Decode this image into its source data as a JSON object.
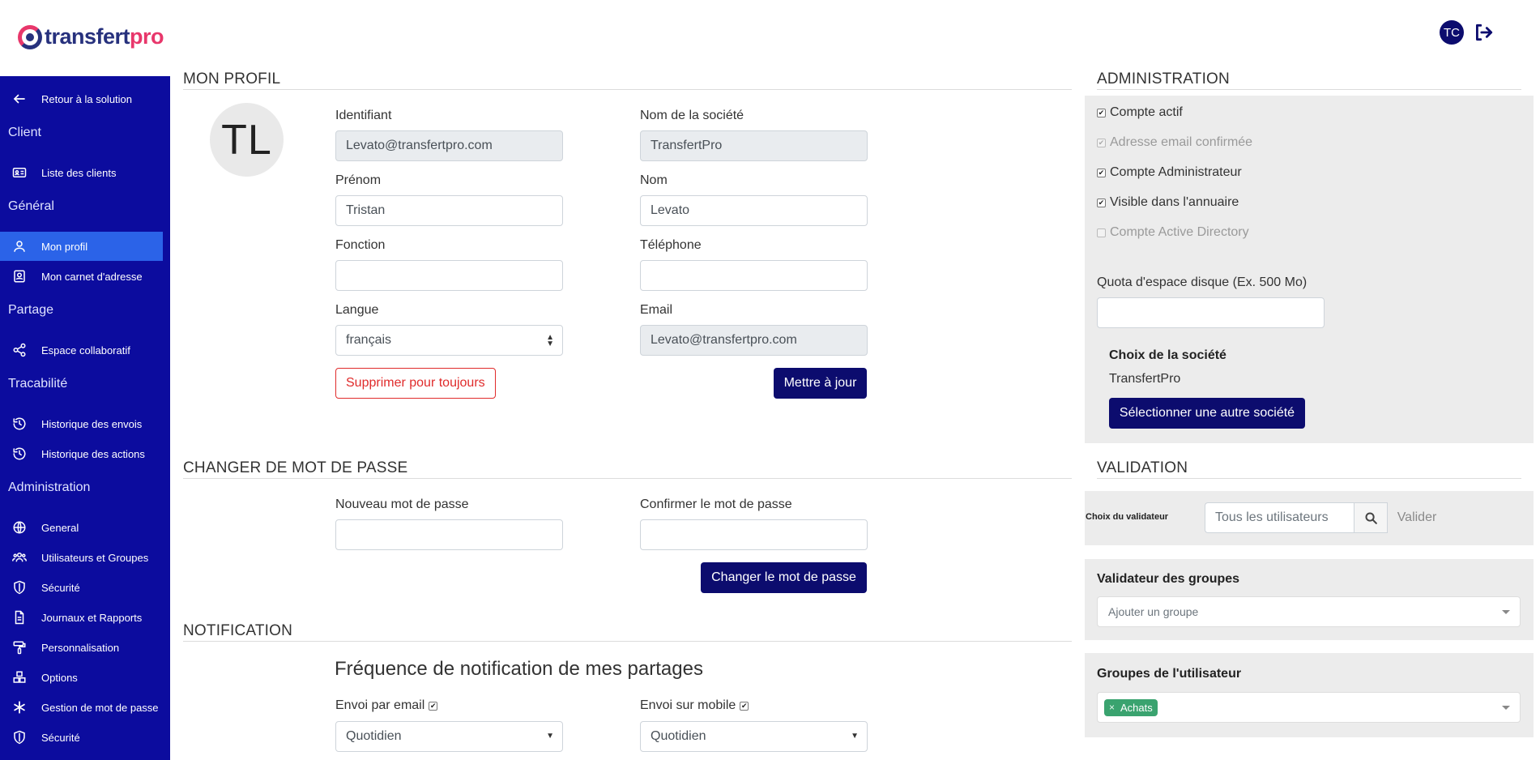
{
  "header": {
    "logo_left": "transfert",
    "logo_right": "pro",
    "user_initials": "TC"
  },
  "sidebar": {
    "back": "Retour à la solution",
    "sections": {
      "client": "Client",
      "general": "Général",
      "partage": "Partage",
      "tracabilite": "Tracabilité",
      "administration": "Administration"
    },
    "items": {
      "clients": "Liste des clients",
      "profil": "Mon profil",
      "carnet": "Mon carnet d'adresse",
      "espace": "Espace collaboratif",
      "hist_envois": "Historique des envois",
      "hist_actions": "Historique des actions",
      "general": "General",
      "users": "Utilisateurs et Groupes",
      "securite1": "Sécurité",
      "journaux": "Journaux et Rapports",
      "perso": "Personnalisation",
      "options": "Options",
      "mdp": "Gestion de mot de passe",
      "securite2": "Sécurité"
    }
  },
  "profile": {
    "title": "MON PROFIL",
    "avatar": "TL",
    "identifiant_label": "Identifiant",
    "identifiant_value": "Levato@transfertpro.com",
    "societe_label": "Nom de la société",
    "societe_value": "TransfertPro",
    "prenom_label": "Prénom",
    "prenom_value": "Tristan",
    "nom_label": "Nom",
    "nom_value": "Levato",
    "fonction_label": "Fonction",
    "fonction_value": "",
    "telephone_label": "Téléphone",
    "telephone_value": "",
    "langue_label": "Langue",
    "langue_value": "français",
    "email_label": "Email",
    "email_value": "Levato@transfertpro.com",
    "delete_btn": "Supprimer pour toujours",
    "update_btn": "Mettre à jour"
  },
  "password": {
    "title": "CHANGER DE MOT DE PASSE",
    "new_label": "Nouveau mot de passe",
    "confirm_label": "Confirmer le mot de passe",
    "submit": "Changer le mot de passe"
  },
  "notification": {
    "title": "NOTIFICATION",
    "heading": "Fréquence de notification de mes partages",
    "email_label": "Envoi par email",
    "email_checked": true,
    "mobile_label": "Envoi sur mobile",
    "mobile_checked": true,
    "email_freq": "Quotidien",
    "mobile_freq": "Quotidien"
  },
  "administration": {
    "title": "ADMINISTRATION",
    "checks": {
      "actif": "Compte actif",
      "email": "Adresse email confirmée",
      "admin": "Compte Administrateur",
      "annuaire": "Visible dans l'annuaire",
      "ad": "Compte Active Directory"
    },
    "quota_label": "Quota d'espace disque (Ex. 500 Mo)",
    "quota_value": "",
    "company_title": "Choix de la société",
    "company_name": "TransfertPro",
    "company_btn": "Sélectionner une autre société"
  },
  "validation": {
    "title": "VALIDATION",
    "label": "Choix du validateur",
    "placeholder": "Tous les utilisateurs",
    "valider": "Valider",
    "groups_validator_title": "Validateur des groupes",
    "groups_validator_placeholder": "Ajouter un groupe",
    "user_groups_title": "Groupes de l'utilisateur",
    "user_groups_tag": "Achats"
  },
  "colors": {
    "sidebar_bg": "#0c0c9e",
    "sidebar_active": "#2b63e8",
    "primary": "#0c0c6e",
    "danger": "#e02b2b",
    "tag": "#3aa36f"
  }
}
